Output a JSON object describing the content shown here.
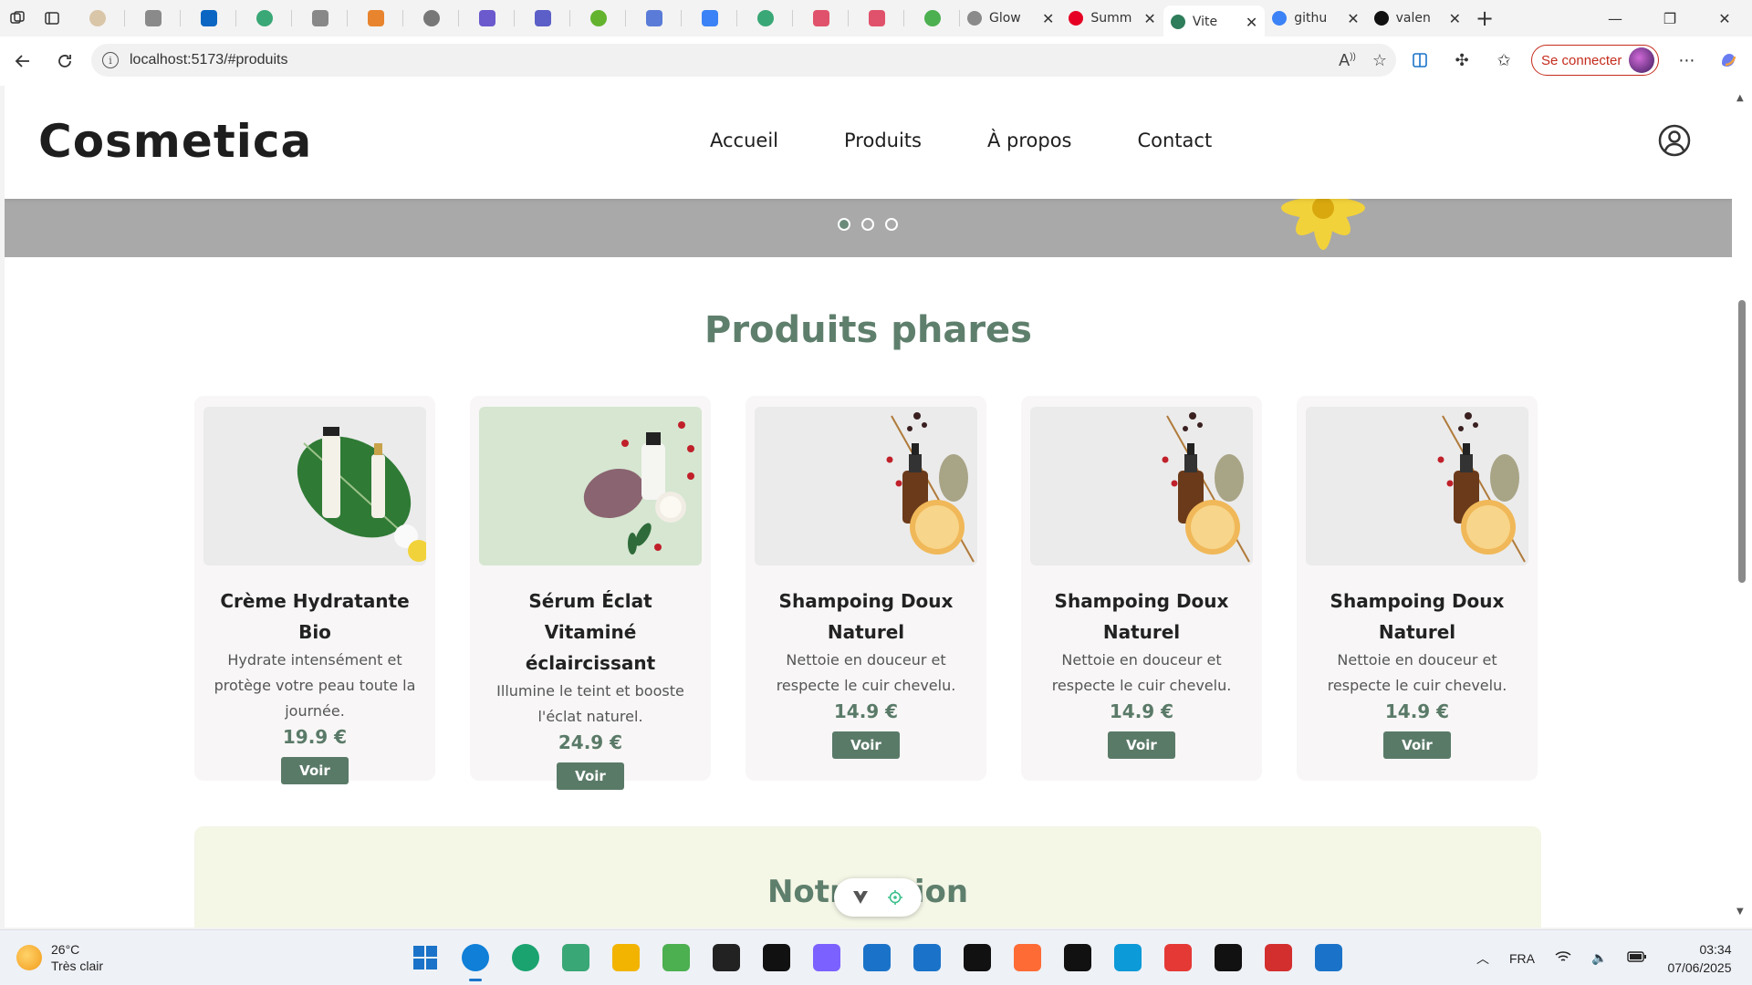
{
  "browser": {
    "pinned_tab_count": 16,
    "pinned_tab_colors": [
      "#d9c6a8",
      "#8a8a8a",
      "#0a66c2",
      "#3aa776",
      "#888888",
      "#e8842e",
      "#777777",
      "#6a5acd",
      "#5b5fc7",
      "#63b32e",
      "#5a7bd8",
      "#3b82f6",
      "#3aa776",
      "#e0526b",
      "#e0526b",
      "#4caf50"
    ],
    "tabs": [
      {
        "title": "Glow",
        "favicon": "G",
        "favicon_color": "#8a8a8a"
      },
      {
        "title": "Summ",
        "favicon": "P",
        "favicon_color": "#e60023"
      },
      {
        "title": "Vite",
        "favicon": "V",
        "favicon_color": "#2e7d5b",
        "active": true
      },
      {
        "title": "githu",
        "favicon": "search",
        "favicon_color": "#3b82f6"
      },
      {
        "title": "valen",
        "favicon": "github",
        "favicon_color": "#111111"
      }
    ],
    "url": "localhost:5173/#produits",
    "signin_label": "Se connecter"
  },
  "site": {
    "logo": "Cosmetica",
    "nav": [
      "Accueil",
      "Produits",
      "À propos",
      "Contact"
    ],
    "section_title": "Produits phares",
    "next_section_title_left": "Notr",
    "next_section_title_right": "ion"
  },
  "products": [
    {
      "name": "Crème Hydratante Bio",
      "desc": "Hydrate intensément et protège votre peau toute la journée.",
      "price": "19.9 €",
      "button": "Voir",
      "img": "cream"
    },
    {
      "name": "Sérum Éclat Vitaminé éclaircissant",
      "desc": "Illumine le teint et booste l'éclat naturel.",
      "price": "24.9 €",
      "button": "Voir",
      "img": "serum"
    },
    {
      "name": "Shampoing Doux Naturel",
      "desc": "Nettoie en douceur et respecte le cuir chevelu.",
      "price": "14.9 €",
      "button": "Voir",
      "img": "oil"
    },
    {
      "name": "Shampoing Doux Naturel",
      "desc": "Nettoie en douceur et respecte le cuir chevelu.",
      "price": "14.9 €",
      "button": "Voir",
      "img": "oil"
    },
    {
      "name": "Shampoing Doux Naturel",
      "desc": "Nettoie en douceur et respecte le cuir chevelu.",
      "price": "14.9 €",
      "button": "Voir",
      "img": "oil"
    }
  ],
  "colors": {
    "accent": "#5a7a68",
    "hero_bg": "#a9a9a9",
    "mission_bg": "#f4f6e6"
  },
  "taskbar": {
    "weather_temp": "26°C",
    "weather_desc": "Très clair",
    "language": "FRA",
    "time": "03:34",
    "date": "07/06/2025",
    "app_colors": [
      "#1a73c8",
      "#0f7fd8",
      "#1aa36f",
      "#3aa776",
      "#f2b400",
      "#4caf50",
      "#222222",
      "#111111",
      "#7b61ff",
      "#1a73c8",
      "#1a73c8",
      "#111111",
      "#ff6b35",
      "#111111",
      "#0c9ad8",
      "#e53935",
      "#111111",
      "#d32f2f",
      "#1a73c8"
    ]
  }
}
